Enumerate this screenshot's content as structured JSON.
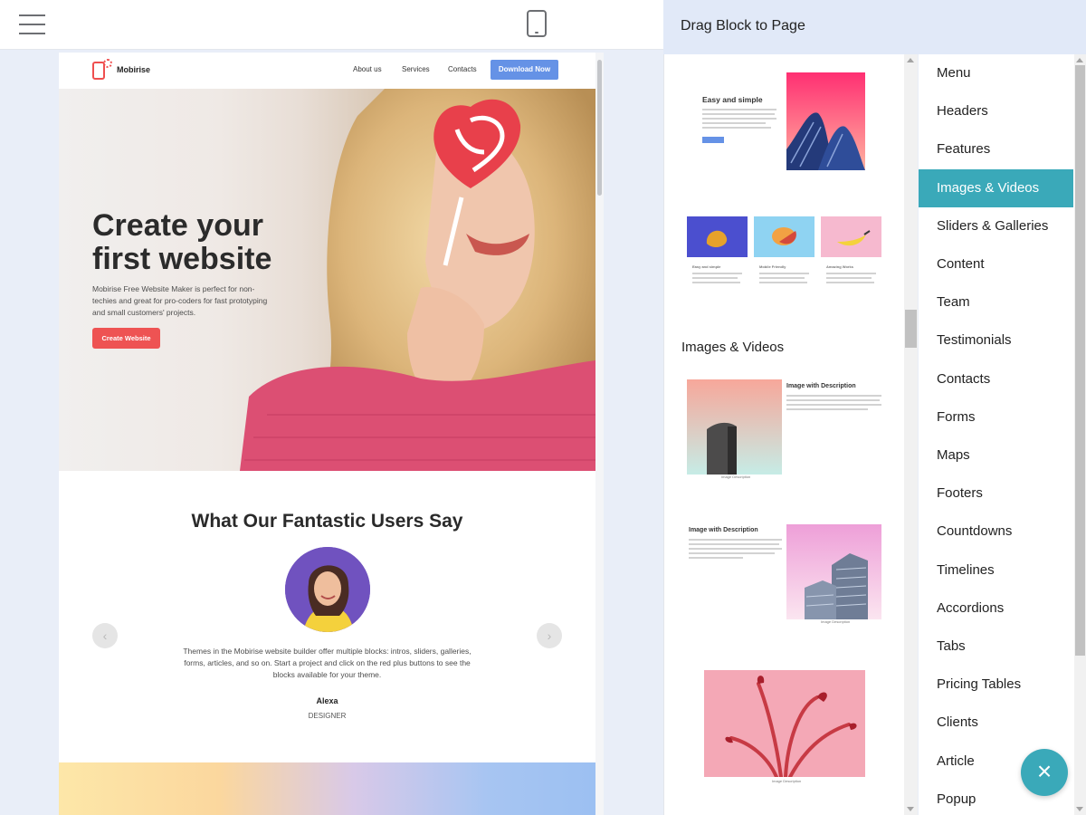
{
  "editor": {
    "menu_icon": "hamburger-icon",
    "device_icon": "mobile-phone-icon"
  },
  "site": {
    "logo_text": "Mobirise",
    "nav_links": [
      "About us",
      "Services",
      "Contacts"
    ],
    "download_label": "Download Now",
    "hero": {
      "title_line1": "Create your",
      "title_line2": "first website",
      "text": "Mobirise Free Website Maker is perfect for non-techies and great for pro-coders for fast prototyping and small customers' projects.",
      "button_label": "Create Website"
    },
    "testimonials": {
      "title": "What Our Fantastic Users Say",
      "text": "Themes in the Mobirise website builder offer multiple blocks: intros, sliders, galleries, forms, articles, and so on. Start a project and click on the red plus buttons to see the blocks available for your theme.",
      "name": "Alexa",
      "role": "DESIGNER",
      "prev_icon": "‹",
      "next_icon": "›"
    }
  },
  "panel": {
    "title": "Drag Block to Page",
    "section_heading": "Images & Videos",
    "previews": {
      "easy_title": "Easy and simple",
      "feature_titles": [
        "Easy and simple",
        "Mobile Friendly",
        "Amazing Works"
      ],
      "image_with_description": "Image with Description",
      "caption": "Image Description"
    },
    "categories": [
      "Menu",
      "Headers",
      "Features",
      "Images & Videos",
      "Sliders & Galleries",
      "Content",
      "Team",
      "Testimonials",
      "Contacts",
      "Forms",
      "Maps",
      "Footers",
      "Countdowns",
      "Timelines",
      "Accordions",
      "Tabs",
      "Pricing Tables",
      "Clients",
      "Article",
      "Popup"
    ],
    "active_category": "Images & Videos",
    "fab_icon": "×"
  },
  "colors": {
    "accent": "#3aa9b9",
    "primary_button": "#6592e6",
    "hero_button": "#ee5353",
    "panel_header": "#e1e9f8"
  }
}
